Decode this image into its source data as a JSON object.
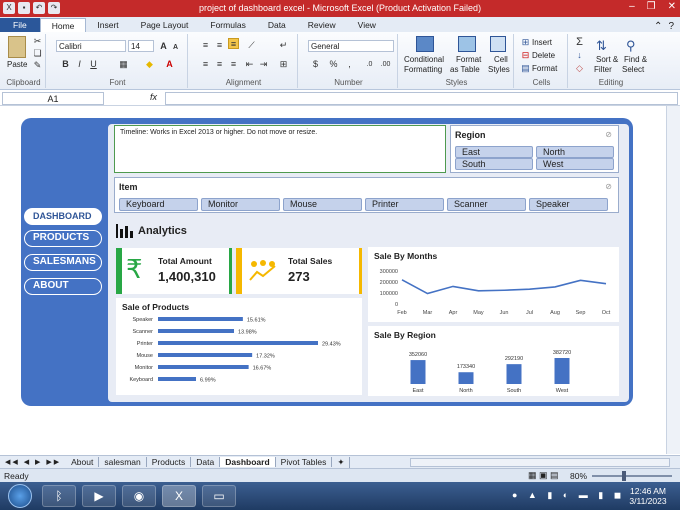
{
  "window": {
    "title": "project of dashboard excel  -  Microsoft Excel (Product Activation Failed)"
  },
  "ribbon_tabs": [
    "File",
    "Home",
    "Insert",
    "Page Layout",
    "Formulas",
    "Data",
    "Review",
    "View"
  ],
  "ribbon": {
    "paste": "Paste",
    "font_name": "Calibri",
    "font_size": "14",
    "number_format": "General",
    "conditional": "Conditional",
    "formatting": "Formatting",
    "format_as": "Format",
    "as_table": "as Table",
    "cell": "Cell",
    "styles_label": "Styles",
    "insert": "Insert",
    "delete": "Delete",
    "format": "Format",
    "sort": "Sort &",
    "filter": "Filter",
    "find": "Find &",
    "select": "Select",
    "groups": [
      "Clipboard",
      "Font",
      "Alignment",
      "Number",
      "Styles",
      "Cells",
      "Editing"
    ]
  },
  "formula_bar": {
    "name_box": "A1",
    "fx": "fx"
  },
  "dashboard": {
    "timeline_text": "Timeline: Works in Excel 2013 or higher. Do not move or resize.",
    "region_title": "Region",
    "regions": [
      "East",
      "North",
      "South",
      "West"
    ],
    "item_title": "Item",
    "items": [
      "Keyboard",
      "Monitor",
      "Mouse",
      "Printer",
      "Scanner",
      "Speaker"
    ],
    "nav": [
      "DASHBOARD",
      "PRODUCTS",
      "SALESMANS",
      "ABOUT"
    ],
    "analytics_title": "Analytics",
    "total_amount_label": "Total Amount",
    "total_amount_value": "1,400,310",
    "total_sales_label": "Total Sales",
    "total_sales_value": "273",
    "colors": {
      "frame": "#4472c4",
      "green": "#28a745",
      "gold": "#f5b800",
      "series": "#4472c4"
    }
  },
  "chart_data": [
    {
      "type": "line",
      "title": "Sale By Months",
      "categories": [
        "Feb",
        "Mar",
        "Apr",
        "May",
        "Jun",
        "Jul",
        "Aug",
        "Sep",
        "Oct"
      ],
      "values": [
        220000,
        95000,
        160000,
        120000,
        125000,
        135000,
        155000,
        215000,
        185000
      ],
      "yticks": [
        "300000",
        "200000",
        "100000",
        "0"
      ],
      "ylim": [
        0,
        300000
      ]
    },
    {
      "type": "bar",
      "orientation": "horizontal",
      "title": "Sale of Products",
      "categories": [
        "Speaker",
        "Scanner",
        "Printer",
        "Mouse",
        "Monitor",
        "Keyboard"
      ],
      "values": [
        15.61,
        13.98,
        29.43,
        17.32,
        16.67,
        6.99
      ],
      "labels": [
        "15.61%",
        "13.98%",
        "29.43%",
        "17.32%",
        "16.67%",
        "6.99%"
      ]
    },
    {
      "type": "bar",
      "title": "Sale By Region",
      "categories": [
        "East",
        "North",
        "South",
        "West"
      ],
      "values": [
        352060,
        173340,
        292190,
        382720
      ],
      "labels": [
        "352060",
        "173340",
        "292190",
        "382720"
      ]
    }
  ],
  "sheet_tabs": [
    "About",
    "salesman",
    "Products",
    "Data",
    "Dashboard",
    "Pivot Tables"
  ],
  "status": {
    "left": "Ready",
    "zoom": "80%"
  },
  "taskbar": {
    "time": "12:46 AM",
    "date": "3/11/2023"
  }
}
